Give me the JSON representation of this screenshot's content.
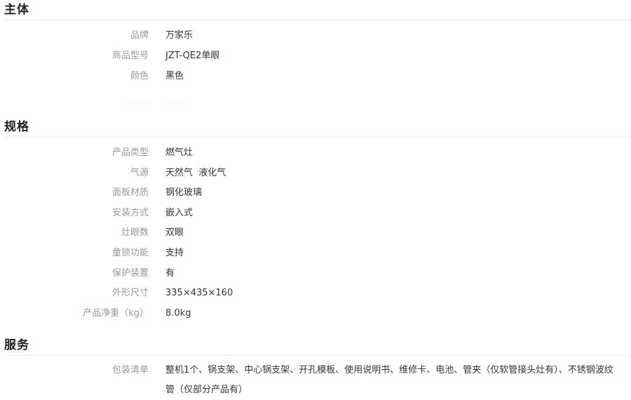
{
  "sections": {
    "main": {
      "title": "主体",
      "rows": [
        {
          "label": "品牌",
          "value": "万家乐"
        },
        {
          "label": "商品型号",
          "value": "JZT-QE2单眼"
        },
        {
          "label": "颜色",
          "value": "黑色"
        }
      ]
    },
    "specs": {
      "title": "规格",
      "rows": [
        {
          "label": "产品类型",
          "value": "燃气灶"
        },
        {
          "label": "气源",
          "value": "天然气  液化气"
        },
        {
          "label": "面板材质",
          "value": "钢化玻璃"
        },
        {
          "label": "安装方式",
          "value": "嵌入式"
        },
        {
          "label": "灶眼数",
          "value": "双眼"
        },
        {
          "label": "童锁功能",
          "value": "支持"
        },
        {
          "label": "保护装置",
          "value": "有"
        },
        {
          "label": "外形尺寸",
          "value": "335×435×160"
        },
        {
          "label": "产品净重（kg）",
          "value": "8.0kg"
        }
      ]
    },
    "service": {
      "title": "服务",
      "rows": [
        {
          "label": "包装清单",
          "value": "整机1个、锅支架、中心锅支架、开孔模板、使用说明书、维修卡、电池、管夹（仅软管接头灶有）、不锈钢波纹管（仅部分产品有）"
        }
      ]
    }
  }
}
